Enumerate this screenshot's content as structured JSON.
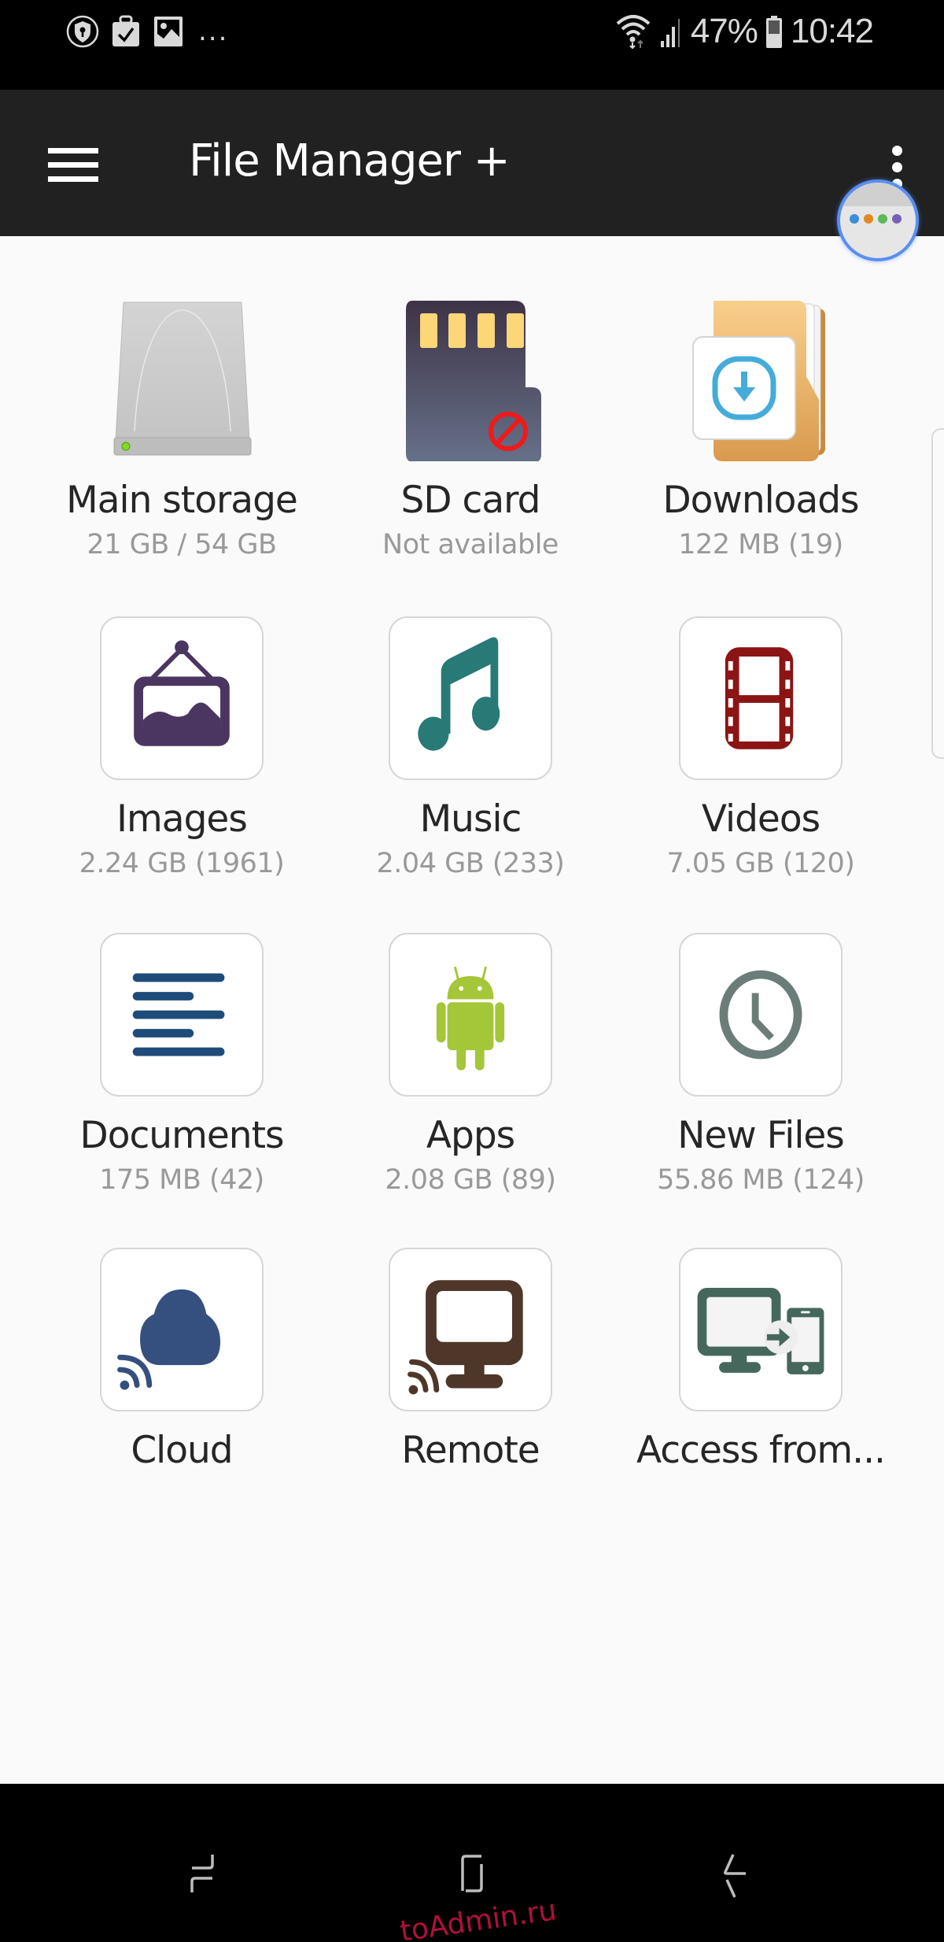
{
  "status_bar": {
    "notification_icons": [
      "vpn-shield-icon",
      "briefcase-check-icon",
      "image-icon"
    ],
    "more_indicator": "...",
    "battery_percent": "47%",
    "time": "10:42",
    "system_icons": [
      "wifi-icon",
      "signal-icon",
      "battery-icon"
    ]
  },
  "app_bar": {
    "title": "File Manager +",
    "menu_icon": "hamburger-icon",
    "overflow_icon": "more-vert-icon"
  },
  "grid": {
    "items": [
      {
        "label": "Main storage",
        "sub": "21 GB / 54 GB",
        "icon": "hard-drive-icon"
      },
      {
        "label": "SD card",
        "sub": "Not available",
        "icon": "sd-card-icon"
      },
      {
        "label": "Downloads",
        "sub": "122 MB (19)",
        "icon": "downloads-folder-icon"
      },
      {
        "label": "Images",
        "sub": "2.24 GB (1961)",
        "icon": "picture-frame-icon",
        "color": "#4a3660"
      },
      {
        "label": "Music",
        "sub": "2.04 GB (233)",
        "icon": "music-note-icon",
        "color": "#277a76"
      },
      {
        "label": "Videos",
        "sub": "7.05 GB (120)",
        "icon": "film-strip-icon",
        "color": "#8b1414"
      },
      {
        "label": "Documents",
        "sub": "175 MB (42)",
        "icon": "document-lines-icon",
        "color": "#1f4b7a"
      },
      {
        "label": "Apps",
        "sub": "2.08 GB (89)",
        "icon": "android-icon",
        "color": "#a4c639"
      },
      {
        "label": "New Files",
        "sub": "55.86 MB (124)",
        "icon": "clock-icon",
        "color": "#6b7d78"
      },
      {
        "label": "Cloud",
        "sub": "",
        "icon": "cloud-icon",
        "color": "#354f7f"
      },
      {
        "label": "Remote",
        "sub": "",
        "icon": "remote-monitor-icon",
        "color": "#4e3729"
      },
      {
        "label": "Access from...",
        "sub": "",
        "icon": "pc-to-phone-icon",
        "color": "#46685c"
      }
    ]
  },
  "nav_bar": {
    "recents": "recent-apps-icon",
    "home": "home-icon",
    "back": "back-icon"
  },
  "watermark": "toAdmin.ru"
}
